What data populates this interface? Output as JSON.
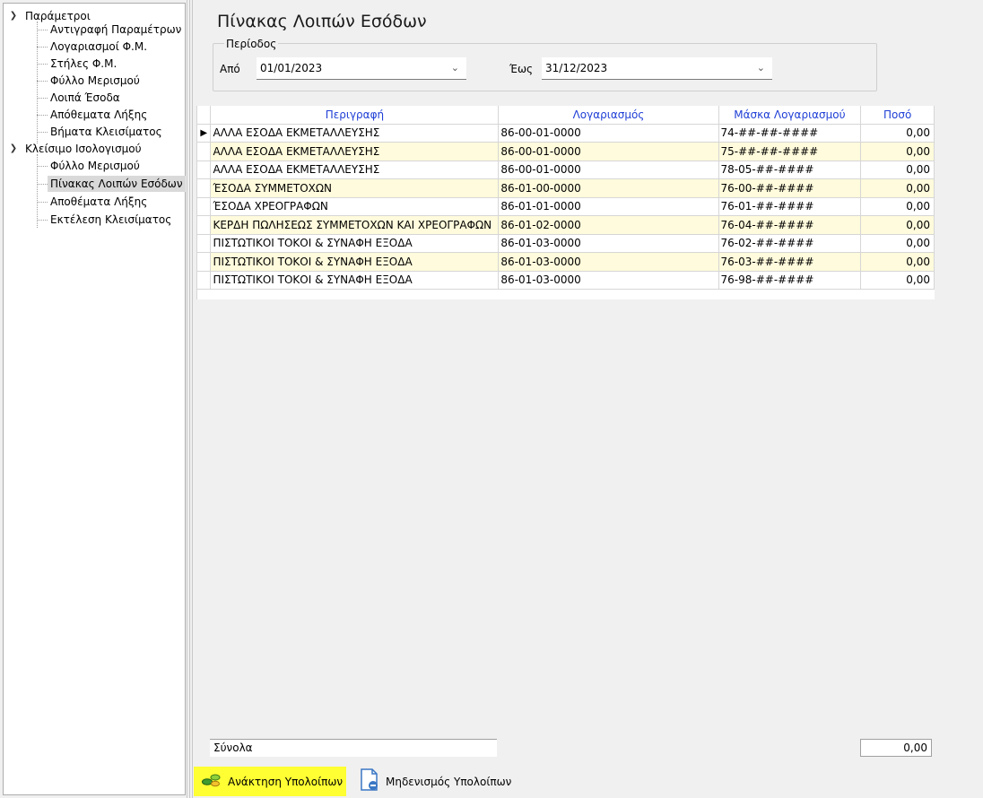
{
  "tree": {
    "groups": [
      {
        "label": "Παράμετροι",
        "children": [
          "Αντιγραφή Παραμέτρων",
          "Λογαριασμοί Φ.Μ.",
          "Στήλες Φ.Μ.",
          "Φύλλο Μερισμού",
          "Λοιπά Έσοδα",
          "Απόθεματα Λήξης",
          "Βήματα Κλεισίματος"
        ]
      },
      {
        "label": "Κλείσιμο Ισολογισμού",
        "children": [
          "Φύλλο Μερισμού",
          "Πίνακας Λοιπών Εσόδων",
          "Αποθέματα Λήξης",
          "Εκτέλεση Κλεισίματος"
        ]
      }
    ],
    "selected": "Πίνακας Λοιπών Εσόδων"
  },
  "main": {
    "title": "Πίνακας Λοιπών Εσόδων",
    "period": {
      "legend": "Περίοδος",
      "from_label": "Από",
      "from_value": "01/01/2023",
      "to_label": "Έως",
      "to_value": "31/12/2023"
    }
  },
  "grid": {
    "columns": [
      "Περιγραφή",
      "Λογαριασμός",
      "Μάσκα Λογαριασμού",
      "Ποσό"
    ],
    "current_row_indicator": "▶",
    "rows": [
      [
        "ΑΛΛΑ ΕΣΟΔΑ ΕΚΜΕΤΑΛΛΕΥΣΗΣ",
        "86-00-01-0000",
        "74-##-##-####",
        "0,00"
      ],
      [
        "ΑΛΛΑ ΕΣΟΔΑ ΕΚΜΕΤΑΛΛΕΥΣΗΣ",
        "86-00-01-0000",
        "75-##-##-####",
        "0,00"
      ],
      [
        "ΑΛΛΑ ΕΣΟΔΑ ΕΚΜΕΤΑΛΛΕΥΣΗΣ",
        "86-00-01-0000",
        "78-05-##-####",
        "0,00"
      ],
      [
        "ΈΣΟΔΑ ΣΥΜΜΕΤΟΧΩΝ",
        "86-01-00-0000",
        "76-00-##-####",
        "0,00"
      ],
      [
        "ΈΣΟΔΑ ΧΡΕΟΓΡΑΦΩΝ",
        "86-01-01-0000",
        "76-01-##-####",
        "0,00"
      ],
      [
        "ΚΕΡΔΗ ΠΩΛΗΣΕΩΣ ΣΥΜΜΕΤΟΧΩΝ ΚΑΙ ΧΡΕΟΓΡΑΦΩΝ",
        "86-01-02-0000",
        "76-04-##-####",
        "0,00"
      ],
      [
        "ΠΙΣΤΩΤΙΚΟΙ ΤΟΚΟΙ & ΣΥΝΑΦΗ ΕΞΟΔΑ",
        "86-01-03-0000",
        "76-02-##-####",
        "0,00"
      ],
      [
        "ΠΙΣΤΩΤΙΚΟΙ ΤΟΚΟΙ & ΣΥΝΑΦΗ ΕΞΟΔΑ",
        "86-01-03-0000",
        "76-03-##-####",
        "0,00"
      ],
      [
        "ΠΙΣΤΩΤΙΚΟΙ ΤΟΚΟΙ & ΣΥΝΑΦΗ ΕΞΟΔΑ",
        "86-01-03-0000",
        "76-98-##-####",
        "0,00"
      ]
    ]
  },
  "totals": {
    "label": "Σύνολα",
    "value": "0,00"
  },
  "toolbar": {
    "fetch_label": "Ανάκτηση Υπολοίπων",
    "fetch_highlight": "#ffff33",
    "zero_label": "Μηδενισμός Υπολοίπων"
  },
  "colors": {
    "header_text": "#1f3fd6",
    "alt_row": "#fffbdc",
    "selected_tree": "#d9d9d9"
  },
  "icons": {
    "expand": "chevron-down-icon",
    "fetch": "coins-icon",
    "zero": "document-minus-icon"
  }
}
